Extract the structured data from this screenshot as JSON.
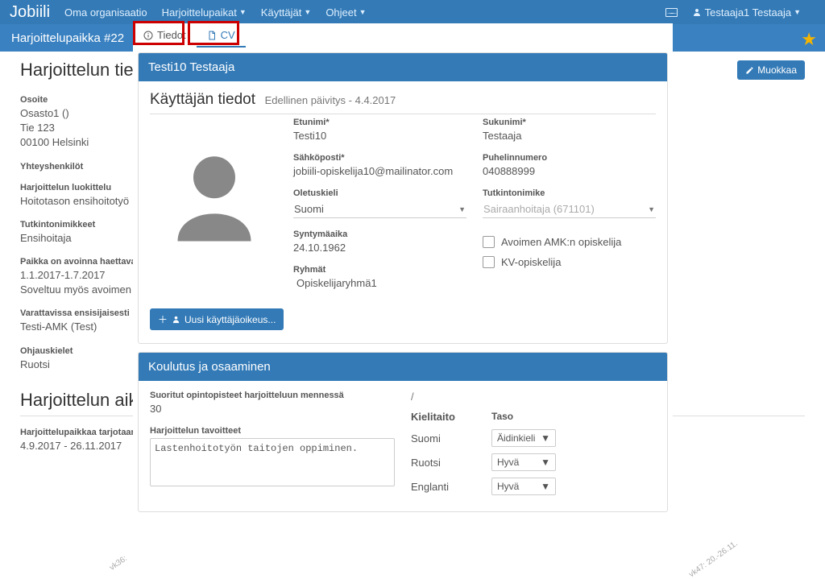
{
  "nav": {
    "brand": "Jobiili",
    "items": [
      "Oma organisaatio",
      "Harjoittelupaikat",
      "Käyttäjät",
      "Ohjeet"
    ],
    "user": "Testaaja1 Testaaja"
  },
  "blueBar": {
    "title": "Harjoittelupaikka #22"
  },
  "page": {
    "title": "Harjoittelun tiedot",
    "edit": "Muokkaa",
    "section2": "Harjoittelun aika"
  },
  "left": {
    "osoite_label": "Osoite",
    "osoite_l1": "Osasto1 ()",
    "osoite_l2": "Tie 123",
    "osoite_l3": "00100 Helsinki",
    "yhteys_label": "Yhteyshenkilöt",
    "luokittelu_label": "Harjoittelun luokittelu",
    "luokittelu_val": "Hoitotason ensihoitotyö",
    "tutkinto_label": "Tutkintonimikkeet",
    "tutkinto_val": "Ensihoitaja",
    "avoinna_label": "Paikka on avoinna haettava",
    "avoinna_val1": "1.1.2017-1.7.2017",
    "avoinna_val2": "Soveltuu myös avoimen",
    "varattavissa_label": "Varattavissa ensisijaisesti",
    "varattavissa_val": "Testi-AMK (Test)",
    "ohjauskielet_label": "Ohjauskielet",
    "ohjauskielet_val": "Ruotsi",
    "tarjotaan_label": "Harjoittelupaikkaa tarjotaan",
    "tarjotaan_val": "4.9.2017 - 26.11.2017"
  },
  "tabs": {
    "tiedot": "Tiedot",
    "cv": "CV"
  },
  "modal": {
    "heading": "Testi10 Testaaja",
    "subtitle": "Käyttäjän tiedot",
    "updated": "Edellinen päivitys - 4.4.2017",
    "etunimi_label": "Etunimi*",
    "etunimi_val": "Testi10",
    "sukunimi_label": "Sukunimi*",
    "sukunimi_val": "Testaaja",
    "email_label": "Sähköposti*",
    "email_val": "jobiili-opiskelija10@mailinator.com",
    "puh_label": "Puhelinnumero",
    "puh_val": "040888999",
    "oletuskieli_label": "Oletuskieli",
    "oletuskieli_val": "Suomi",
    "tutkinto_label": "Tutkintonimike",
    "tutkinto_val": "Sairaanhoitaja (671101)",
    "syntyma_label": "Syntymäaika",
    "syntyma_val": "24.10.1962",
    "chk1": "Avoimen AMK:n opiskelija",
    "chk2": "KV-opiskelija",
    "ryhmat_label": "Ryhmät",
    "ryhmat_val": "Opiskelijaryhmä1",
    "perm_btn": "Uusi käyttäjäoikeus..."
  },
  "koulutus": {
    "heading": "Koulutus ja osaaminen",
    "pisteet_label": "Suoritut opintopisteet harjoitteluun mennessä",
    "pisteet_val": "30",
    "tavoitteet_label": "Harjoittelun tavoitteet",
    "tavoitteet_val": "Lastenhoitotyön taitojen oppiminen.",
    "slash": "/",
    "kielitaito_head": "Kielitaito",
    "taso_head": "Taso",
    "languages": [
      {
        "name": "Suomi",
        "level": "Äidinkieli"
      },
      {
        "name": "Ruotsi",
        "level": "Hyvä"
      },
      {
        "name": "Englanti",
        "level": "Hyvä"
      }
    ]
  },
  "bgchips": {
    "c1": "vk36:",
    "c2": "vk47: 20.-26.11."
  }
}
